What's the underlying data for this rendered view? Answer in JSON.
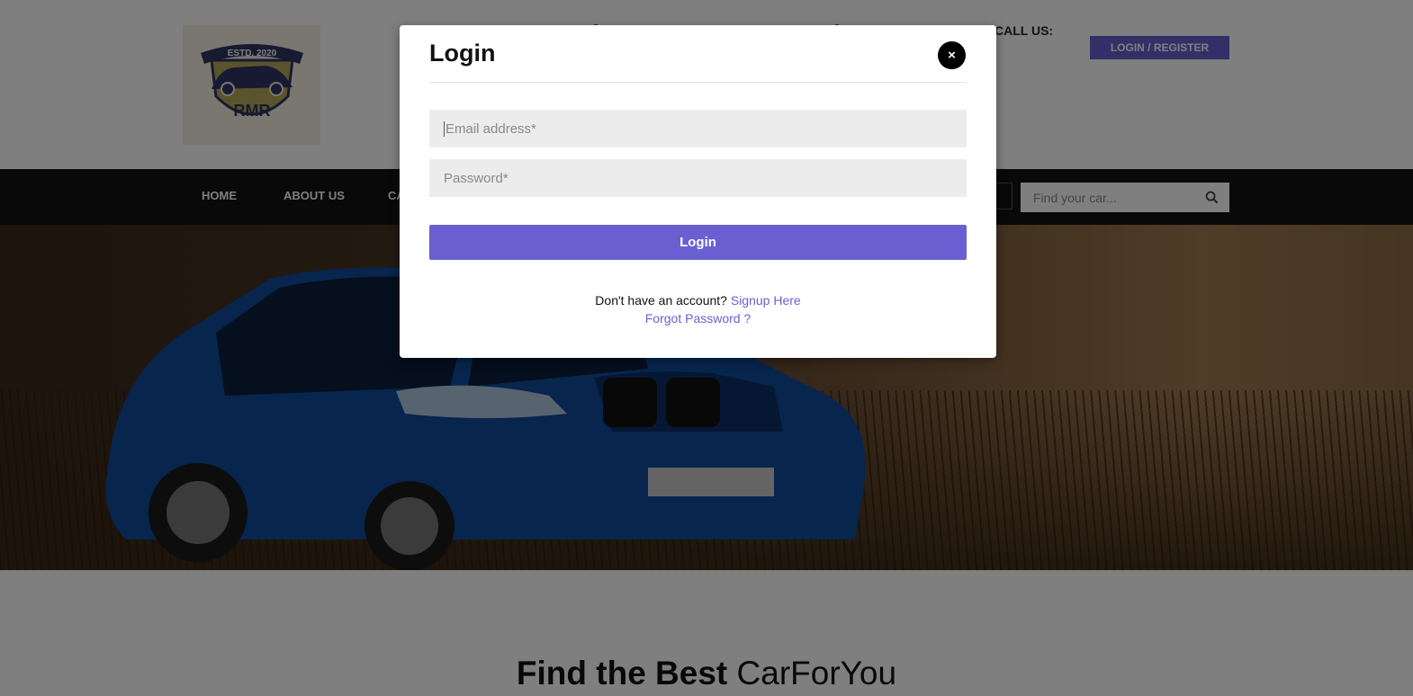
{
  "header": {
    "logo": {
      "top_text": "ESTD. 2020",
      "bottom_text": "RMR"
    },
    "call_us_label": "CALL US:",
    "login_register_label": "LOGIN / REGISTER"
  },
  "nav": {
    "items": [
      "HOME",
      "ABOUT US",
      "CA"
    ],
    "search_placeholder": "Find your car..."
  },
  "section": {
    "title_bold": "Find the Best",
    "title_light": "CarForYou"
  },
  "modal": {
    "title": "Login",
    "close_symbol": "×",
    "email_placeholder": "Email address*",
    "password_placeholder": "Password*",
    "login_button": "Login",
    "signup_prompt": "Don't have an account?",
    "signup_link": "Signup Here",
    "forgot_link": "Forgot Password ?"
  },
  "colors": {
    "accent": "#6a5fd1",
    "nav_bg": "#121212",
    "overlay": "rgba(0,0,0,0.5)"
  }
}
